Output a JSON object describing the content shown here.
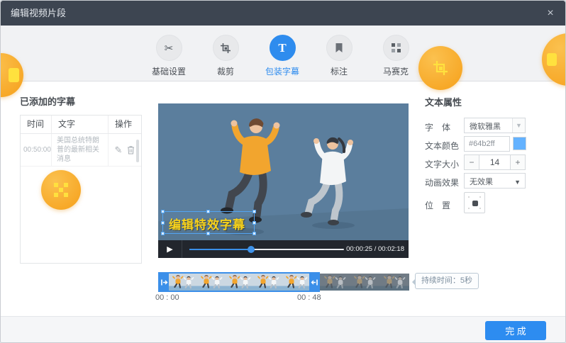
{
  "dialog": {
    "title": "编辑视频片段"
  },
  "icons": {
    "close": "×",
    "scissors": "✂",
    "text_tool": "T",
    "pencil": "✎",
    "play": "▶",
    "dropdown": "▼",
    "minus": "−",
    "plus": "+"
  },
  "toolbar": {
    "tabs": [
      {
        "label": "基础设置",
        "icon": "scissors-icon",
        "active": false
      },
      {
        "label": "裁剪",
        "icon": "crop-icon",
        "active": false
      },
      {
        "label": "包装字幕",
        "icon": "text-icon",
        "active": true
      },
      {
        "label": "标注",
        "icon": "bookmark-icon",
        "active": false
      },
      {
        "label": "马赛克",
        "icon": "mosaic-icon",
        "active": false
      }
    ]
  },
  "subtitle_panel": {
    "title": "已添加的字幕",
    "columns": [
      "时间",
      "文字",
      "操作"
    ],
    "rows": [
      {
        "time": "00:50:00",
        "text": "美国总统特朗普的最新相关消息"
      }
    ]
  },
  "preview": {
    "subtitle_overlay": "编辑特效字幕",
    "time_display": "00:00:25 / 00:02:18",
    "progress_percent": 40
  },
  "properties_panel": {
    "title": "文本属性",
    "font_label": "字　体",
    "font_value": "微软雅黑",
    "color_label": "文本颜色",
    "color_value": "#64b2ff",
    "size_label": "文字大小",
    "size_value": "14",
    "animation_label": "动画效果",
    "animation_value": "无效果",
    "position_label": "位　置"
  },
  "timeline": {
    "start_label": "00 : 00",
    "end_label": "00 : 48",
    "duration_tooltip": "持续时间：5秒"
  },
  "footer": {
    "done_label": "完 成"
  },
  "colors": {
    "accent": "#2d8cf0",
    "text_color_value": "#64b2ff",
    "subtitle_yellow": "#f8d21b",
    "badge_orange": "#f7a827",
    "video_background": "#5b7e9d"
  }
}
